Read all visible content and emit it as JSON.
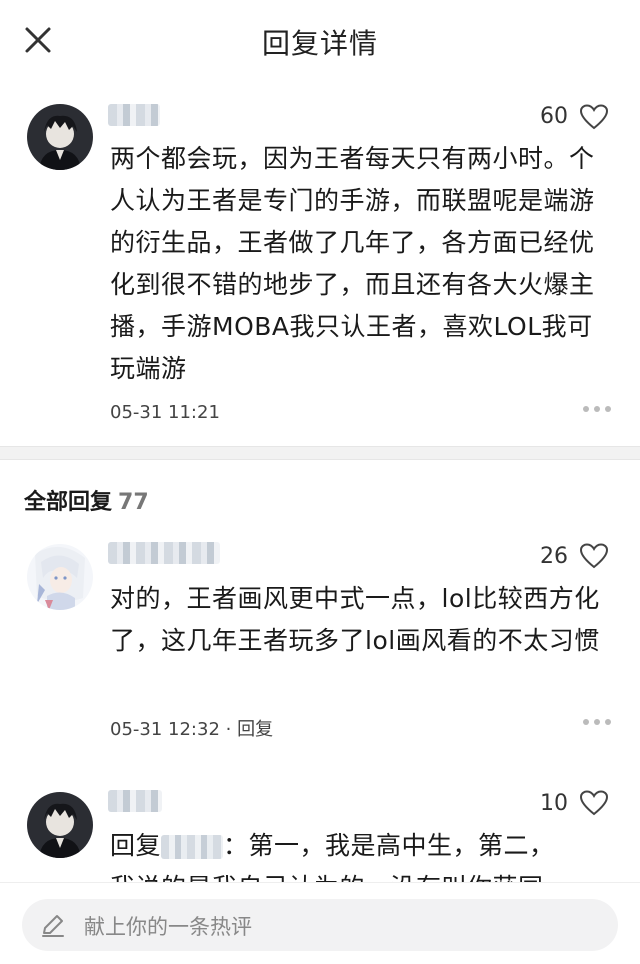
{
  "header": {
    "title": "回复详情"
  },
  "main_comment": {
    "likes": "60",
    "text": "两个都会玩，因为王者每天只有两小时。个人认为王者是专门的手游，而联盟呢是端游的衍生品，王者做了几年了，各方面已经优化到很不错的地步了，而且还有各大火爆主播，手游MOBA我只认王者，喜欢LOL我可玩端游",
    "time": "05-31 11:21"
  },
  "replies_section": {
    "title": "全部回复",
    "count": "77"
  },
  "replies": [
    {
      "likes": "26",
      "text": "对的，王者画风更中式一点，lol比较西方化了，这几年王者玩多了lol画风看的不太习惯",
      "time": "05-31 12:32",
      "reply_label": "· 回复"
    },
    {
      "likes": "10",
      "reply_prefix": "回复",
      "text_after": "：第一，我是高中生，第二，",
      "text_cut": "我说的是我自己认为的，没有叫你获同"
    }
  ],
  "composer": {
    "placeholder": "献上你的一条热评"
  },
  "icons": {
    "close": "close-icon",
    "like": "heart-outline-icon",
    "more": "more-dots-icon",
    "edit": "pencil-icon"
  }
}
